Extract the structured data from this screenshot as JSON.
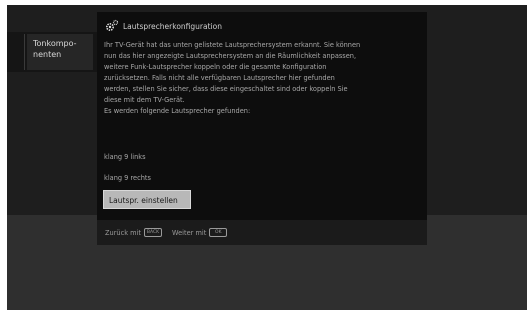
{
  "sidebar": {
    "items": [
      {
        "label": ""
      },
      {
        "label": "Tonkompo-\nnenten"
      }
    ]
  },
  "dialog": {
    "title": "Lautsprecherkonfiguration",
    "icon": "gear-icon",
    "lines": [
      "Ihr TV-Gerät hat das unten gelistete Lautsprechersystem erkannt. Sie können",
      "nun das hier angezeigte Lautsprechersystem an die Räumlichkeit anpassen,",
      "weitere Funk-Lautsprecher koppeln oder die gesamte Konfiguration",
      "zurücksetzen. Falls nicht alle verfügbaren Lautsprecher hier gefunden",
      "werden, stellen Sie sicher, dass diese eingeschaltet sind oder koppeln Sie",
      "diese mit dem TV-Gerät.",
      "Es werden folgende Lautsprecher gefunden:"
    ],
    "speakers": [
      "klang 9 links",
      "klang 9 rechts"
    ],
    "button_label": "Lautspr. einstellen",
    "footer": [
      {
        "text": "Zurück mit",
        "key": "BACK"
      },
      {
        "text": "Weiter mit",
        "key": "OK"
      }
    ]
  },
  "colors": {
    "screen_bg": "#2d2d2d",
    "dialog_bg": "#0d0d0d",
    "button_bg": "#b8b8b8",
    "text": "#a8a8a8"
  }
}
